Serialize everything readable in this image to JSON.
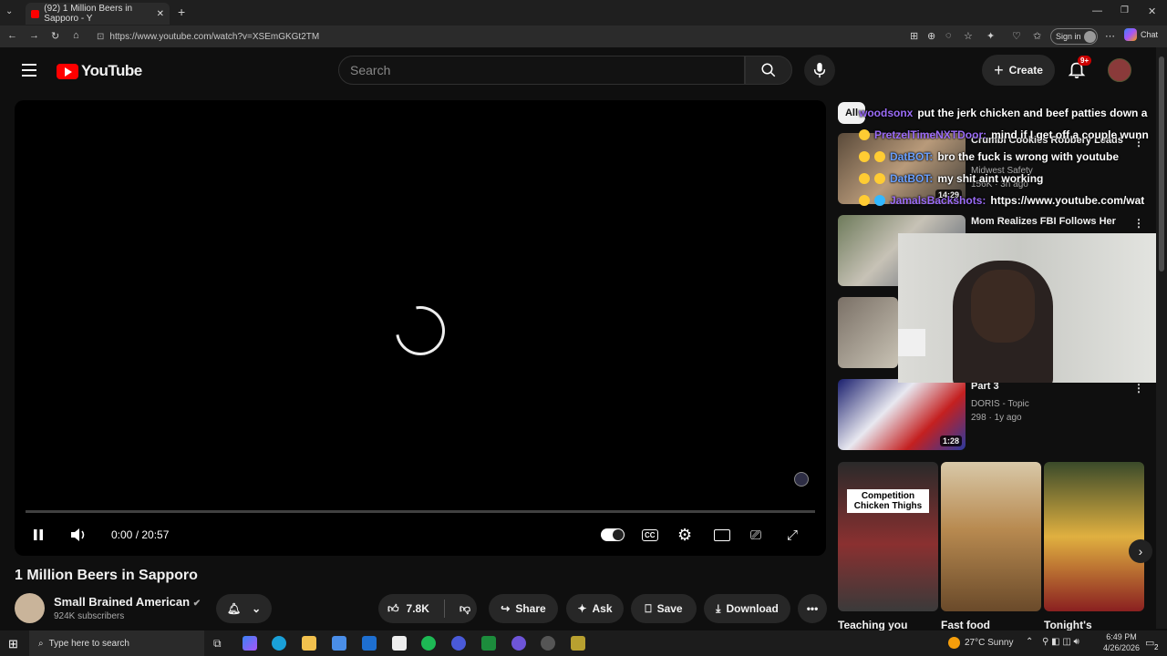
{
  "browser": {
    "tab_title": "(92) 1 Million Beers in Sapporo - Y",
    "url": "https://www.youtube.com/watch?v=XSEmGKGt2TM",
    "sign_in": "Sign in",
    "chat": "Chat"
  },
  "header": {
    "logo_text": "YouTube",
    "search_placeholder": "Search",
    "create_label": "Create",
    "notification_count": "9+"
  },
  "player": {
    "time": "0:00 / 20:57",
    "progress": 0
  },
  "video": {
    "title": "1 Million Beers in Sapporo",
    "channel": "Small Brained American",
    "subscribers": "924K subscribers",
    "likes": "7.8K",
    "share_label": "Share",
    "ask_label": "Ask",
    "save_label": "Save",
    "download_label": "Download"
  },
  "sidebar": {
    "chip_all": "All",
    "videos": [
      {
        "title": "Crumbl Cookies Robbery Leads",
        "channel": "Midwest Safety",
        "meta": "156K · 3h ago",
        "duration": "14:29"
      },
      {
        "title": "Mom Realizes FBI Follows Her",
        "channel": "",
        "meta": "",
        "duration": ""
      },
      {
        "title": "Part 3",
        "channel": "DORIS - Topic",
        "meta": "298 · 1y ago",
        "duration": "1:28"
      }
    ],
    "shorts": [
      {
        "title": "Teaching you",
        "overlay": "Competition Chicken Thighs"
      },
      {
        "title": "Fast food"
      },
      {
        "title": "Tonight's"
      }
    ]
  },
  "chat_overlay": [
    {
      "user": "woodsonx",
      "text": "put the jerk chicken and beef patties down a"
    },
    {
      "user": "PretzelTimeNXTDoor:",
      "text": "mind if I get off a couple wunn"
    },
    {
      "user": "DatBOT:",
      "text": "bro the fuck is wrong with youtube"
    },
    {
      "user": "DatBOT:",
      "text": "my shit aint working"
    },
    {
      "user": "JamalsBackshots:",
      "text": "https://www.youtube.com/wat"
    }
  ],
  "taskbar": {
    "search_placeholder": "Type here to search",
    "weather": "27°C  Sunny",
    "time": "6:49 PM",
    "date": "4/26/2026",
    "notif_count": "2"
  }
}
